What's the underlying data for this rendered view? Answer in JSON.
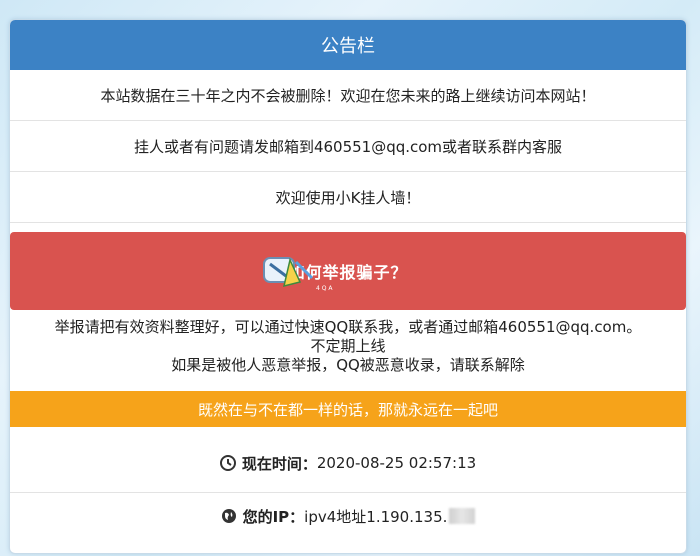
{
  "header": {
    "title": "公告栏"
  },
  "notices": [
    "本站数据在三十年之内不会被删除！欢迎在您未来的路上继续访问本网站！",
    "挂人或者有问题请发邮箱到460551@qq.com或者联系群内客服",
    "欢迎使用小K挂人墙！"
  ],
  "report_button": {
    "label": "如何举报骗子？"
  },
  "report_info": {
    "line1": "举报请把有效资料整理好，可以通过快速QQ联系我，或者通过邮箱460551@qq.com。",
    "line2": "不定期上线",
    "line3": "如果是被他人恶意举报，QQ被恶意收录，请联系解除"
  },
  "slogan": "既然在与不在都一样的话，那就永远在一起吧",
  "time": {
    "label": "现在时间：",
    "value": "2020-08-25 02:57:13"
  },
  "ip": {
    "label": "您的IP：",
    "value": "ipv4地址1.190.135."
  },
  "colors": {
    "header": "#3c82c5",
    "alert": "#d9534f",
    "orange": "#f6a31a"
  },
  "icons": {
    "time": "clock-icon",
    "ip": "globe-icon"
  }
}
